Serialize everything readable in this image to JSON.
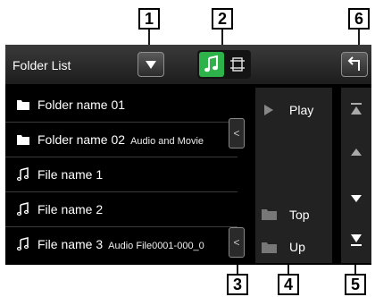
{
  "callouts": {
    "c1": "1",
    "c2": "2",
    "c3": "3",
    "c4": "4",
    "c5": "5",
    "c6": "6"
  },
  "header": {
    "title": "Folder List",
    "dropdown_icon": "triangle-down-icon",
    "mode_icons": [
      "music-note-icon",
      "video-frame-icon"
    ],
    "back_icon": "return-arrow-icon"
  },
  "list": {
    "items": [
      {
        "type": "folder-icon",
        "name": "Folder name 01",
        "extra": ""
      },
      {
        "type": "folder-icon",
        "name": "Folder name 02",
        "extra": "Audio and Movie"
      },
      {
        "type": "music-note-icon",
        "name": "File name 1",
        "extra": ""
      },
      {
        "type": "music-note-icon",
        "name": "File name 2",
        "extra": ""
      },
      {
        "type": "music-note-icon",
        "name": "File name 3",
        "extra": "Audio File0001-000_0"
      }
    ],
    "expand_tab_glyph": "<"
  },
  "controls": {
    "play_label": "Play",
    "top_label": "Top",
    "up_label": "Up"
  },
  "scroll": {
    "icons": [
      "scroll-top-icon",
      "scroll-up-icon",
      "scroll-down-icon",
      "scroll-bottom-icon"
    ]
  },
  "colors": {
    "accent_green": "#2db34a",
    "screen_bg": "#000000"
  }
}
